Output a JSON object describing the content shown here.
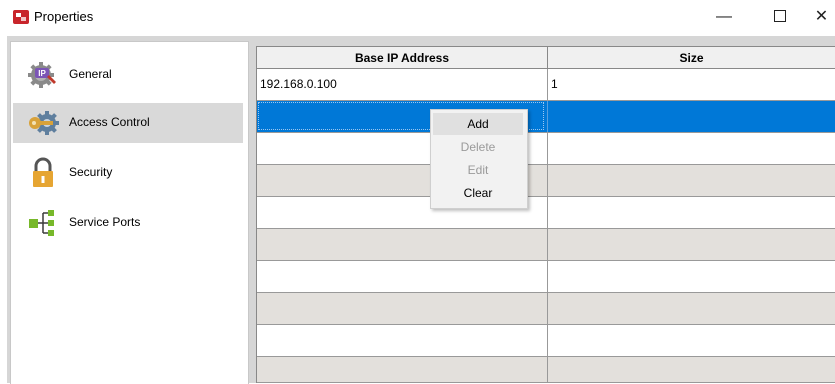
{
  "window": {
    "title": "Properties"
  },
  "sidebar": {
    "items": [
      {
        "label": "General",
        "icon": "ip-gear-icon"
      },
      {
        "label": "Access Control",
        "icon": "key-gear-icon",
        "selected": true
      },
      {
        "label": "Security",
        "icon": "padlock-icon"
      },
      {
        "label": "Service Ports",
        "icon": "network-ports-icon"
      }
    ]
  },
  "table": {
    "columns": [
      "Base IP Address",
      "Size"
    ],
    "rows": [
      {
        "ip": "192.168.0.100",
        "size": "1"
      }
    ]
  },
  "context_menu": {
    "items": [
      {
        "label": "Add",
        "enabled": true,
        "hover": true
      },
      {
        "label": "Delete",
        "enabled": false
      },
      {
        "label": "Edit",
        "enabled": false
      },
      {
        "label": "Clear",
        "enabled": true
      }
    ]
  },
  "colors": {
    "selection": "#0078d7",
    "alt_row": "#e3e0dc",
    "app_icon": "#c8252b"
  }
}
